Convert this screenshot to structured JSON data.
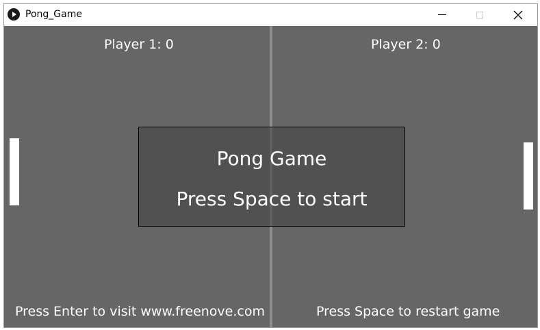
{
  "window": {
    "title": "Pong_Game",
    "app_icon": "play-icon",
    "controls": {
      "minimize": "minimize-icon",
      "maximize": "maximize-icon",
      "close": "close-icon"
    }
  },
  "game": {
    "player1_score": "Player 1: 0",
    "player2_score": "Player 2: 0",
    "dialog_title": "Pong Game",
    "dialog_subtitle": "Press Space to start",
    "hint_left": "Press Enter to visit www.freenove.com",
    "hint_right": "Press Space to restart game"
  },
  "colors": {
    "field": "#666666",
    "net": "#8d8d8d",
    "paddle": "#ffffff",
    "text": "#ffffff"
  }
}
